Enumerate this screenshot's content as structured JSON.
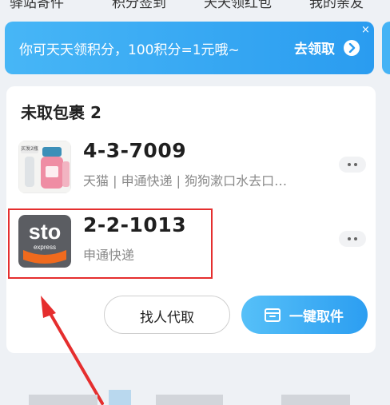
{
  "top_tabs": [
    {
      "label": "驿站寄件"
    },
    {
      "label": "积分签到"
    },
    {
      "label": "天天领红包"
    },
    {
      "label": "我的亲友"
    }
  ],
  "promo": {
    "text": "你可天天领积分，100积分=1元哦~",
    "claim_label": "去领取",
    "close_symbol": "×"
  },
  "parcels": {
    "title": "未取包裹 2",
    "items": [
      {
        "code": "4-3-7009",
        "detail": "天猫 | 申通快递 | 狗狗漱口水去口…",
        "thumb_badge": "买发2瓶"
      },
      {
        "code": "2-2-1013",
        "detail": "申通快递",
        "logo_text": "sto",
        "logo_sub": "express"
      }
    ]
  },
  "actions": {
    "proxy_pickup": "找人代取",
    "one_click_pickup": "一键取件"
  },
  "colors": {
    "accent": "#2a9cf0",
    "highlight": "#e52e2e",
    "sto_orange": "#f06a1d"
  }
}
